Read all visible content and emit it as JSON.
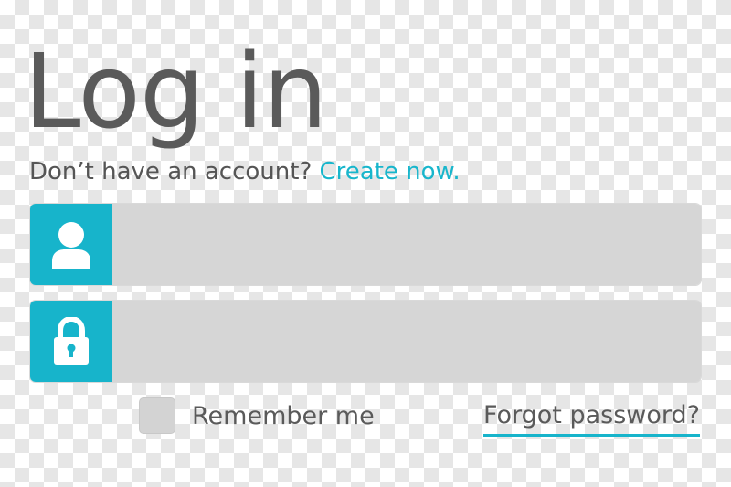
{
  "header": {
    "title": "Log in",
    "prompt_text": "Don’t have an account?",
    "create_link": "Create now."
  },
  "form": {
    "username": {
      "icon": "user-icon",
      "value": "",
      "placeholder": ""
    },
    "password": {
      "icon": "lock-icon",
      "value": "",
      "placeholder": ""
    },
    "remember_label": "Remember me",
    "remember_checked": false,
    "forgot_label": "Forgot password?"
  },
  "colors": {
    "accent": "#17b4cb",
    "field_bg": "#d6d6d6",
    "text": "#5a5a5a"
  }
}
